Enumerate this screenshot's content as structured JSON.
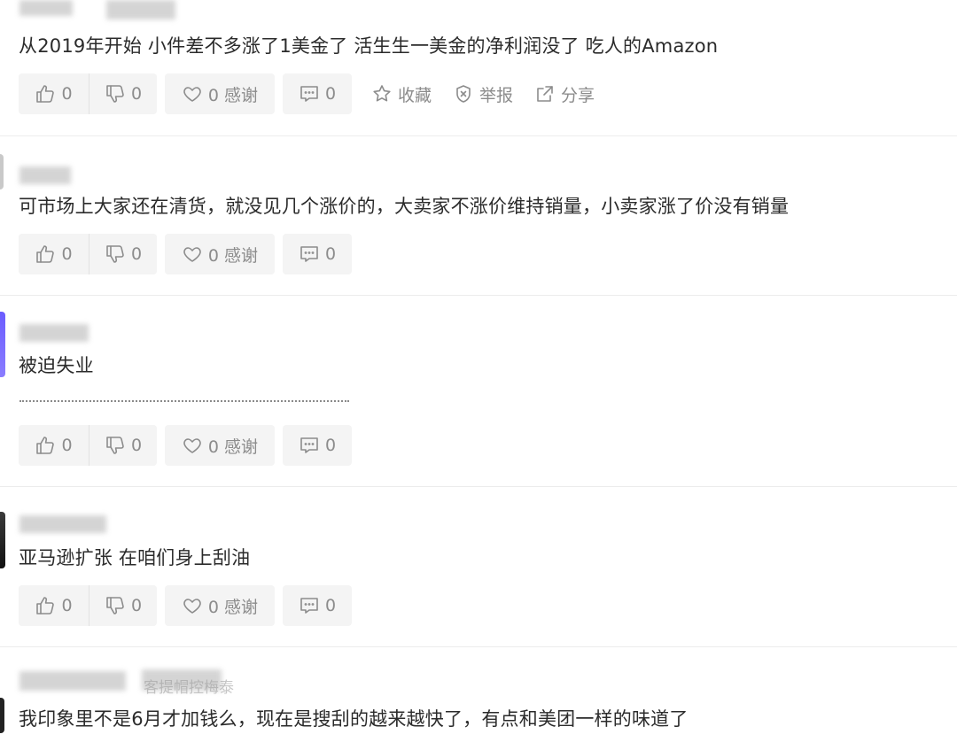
{
  "colors": {
    "divider": "#ececec",
    "button_bg": "#f4f4f4",
    "muted": "#8c8c8c",
    "text": "#2b2b2b"
  },
  "comments": [
    {
      "text": "从2019年开始 小件差不多涨了1美金了 活生生一美金的净利润没了  吃人的Amazon",
      "likes": "0",
      "dislikes": "0",
      "thanks": "0 感谢",
      "replies": "0",
      "extra": {
        "favorite": "收藏",
        "report": "举报",
        "share": "分享"
      }
    },
    {
      "text": "可市场上大家还在清货，就没见几个涨价的，大卖家不涨价维持销量，小卖家涨了价没有销量",
      "likes": "0",
      "dislikes": "0",
      "thanks": "0 感谢",
      "replies": "0"
    },
    {
      "text": "被迫失业",
      "likes": "0",
      "dislikes": "0",
      "thanks": "0 感谢",
      "replies": "0"
    },
    {
      "text": "亚马逊扩张   在咱们身上刮油",
      "likes": "0",
      "dislikes": "0",
      "thanks": "0 感谢",
      "replies": "0"
    },
    {
      "text": "我印象里不是6月才加钱么，现在是搜刮的越来越快了，有点和美团一样的味道了",
      "tag": "客提帽控梅泰"
    }
  ],
  "icons": [
    "thumbs-up-icon",
    "thumbs-down-icon",
    "heart-icon",
    "comment-icon",
    "star-icon",
    "shield-icon",
    "share-icon"
  ]
}
